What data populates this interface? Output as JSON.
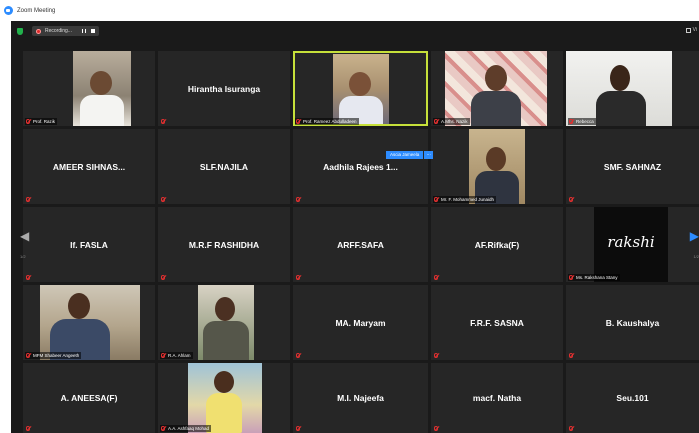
{
  "window": {
    "title": "Zoom Meeting"
  },
  "topbar": {
    "recording_label": "Recording...",
    "view_label": "Vi"
  },
  "colors": {
    "accent": "#2d8cff",
    "active_speaker": "#c6e03a",
    "mic_muted": "#e03030",
    "recording": "#e02828"
  },
  "popup": {
    "name": "Ascia Jameela",
    "more": "..."
  },
  "paging": {
    "left_page": "1/2",
    "right_page": "1/2"
  },
  "tiles": [
    {
      "name": "",
      "label": "Prof. Razik",
      "video": true
    },
    {
      "name": "Hirantha Isuranga",
      "label": "",
      "video": false
    },
    {
      "name": "",
      "label": "Prof. Rameez Abdulladeen",
      "video": true
    },
    {
      "name": "",
      "label": "A.Mhs. Nazik",
      "video": true
    },
    {
      "name": "",
      "label": "Rebecca",
      "video": true
    },
    {
      "name": "AMEER SIHNAS...",
      "label": "",
      "video": false
    },
    {
      "name": "SLF.NAJILA",
      "label": "",
      "video": false
    },
    {
      "name": "Aadhila Rajees 1...",
      "label": "",
      "video": false
    },
    {
      "name": "",
      "label": "Mr. F. Mohammed Junaidh",
      "video": true
    },
    {
      "name": "SMF. SAHNAZ",
      "label": "",
      "video": false
    },
    {
      "name": "If. FASLA",
      "label": "",
      "video": false
    },
    {
      "name": "M.R.F RASHIDHA",
      "label": "",
      "video": false
    },
    {
      "name": "ARFF.SAFA",
      "label": "",
      "video": false
    },
    {
      "name": "AF.Rifka(F)",
      "label": "",
      "video": false
    },
    {
      "name": "",
      "label": "Ms. Rakshana Stany",
      "video": true,
      "overlay_text": "rakshi"
    },
    {
      "name": "",
      "label": "MFM Shabeer Angeeth",
      "video": true
    },
    {
      "name": "",
      "label": "R.A. Ahlam",
      "video": true
    },
    {
      "name": "MA. Maryam",
      "label": "",
      "video": false
    },
    {
      "name": "F.R.F. SASNA",
      "label": "",
      "video": false
    },
    {
      "name": "B. Kaushalya",
      "label": "",
      "video": false
    },
    {
      "name": "A. ANEESA(F)",
      "label": "",
      "video": false
    },
    {
      "name": "",
      "label": "A.A. Ashfaaq Mohad",
      "video": true
    },
    {
      "name": "M.I. Najeefa",
      "label": "",
      "video": false
    },
    {
      "name": "macf. Natha",
      "label": "",
      "video": false
    },
    {
      "name": "Seu.101",
      "label": "",
      "video": false
    }
  ]
}
